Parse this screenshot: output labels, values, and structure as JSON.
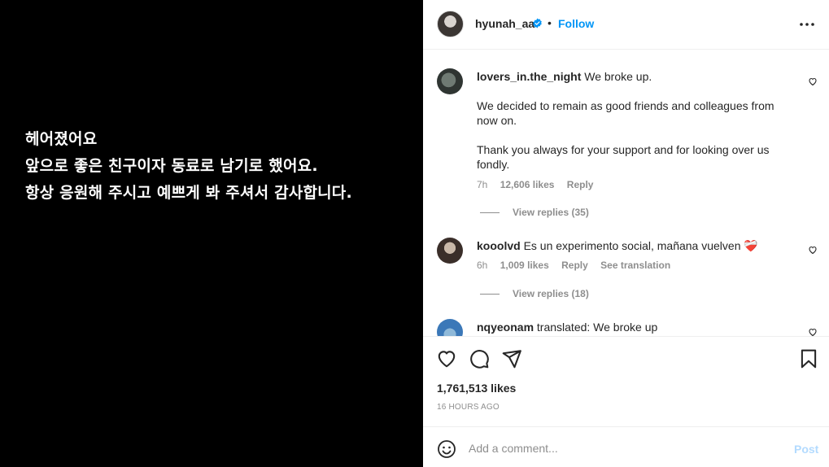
{
  "media": {
    "caption_lines": [
      "헤어졌어요",
      "앞으로 좋은 친구이자 동료로 남기로 했어요.",
      "항상 응원해 주시고 예쁘게 봐 주셔서 감사합니다."
    ]
  },
  "header": {
    "username": "hyunah_aa",
    "separator": "•",
    "follow_label": "Follow",
    "verified_icon": "verified-badge-icon",
    "accent_color": "#0095f6"
  },
  "comments": [
    {
      "username": "lovers_in.the_night",
      "paragraphs": [
        "We broke up.",
        "We decided to remain as good friends and colleagues from now on.",
        "Thank you always for your support and for looking over us fondly."
      ],
      "time": "7h",
      "likes": "12,606 likes",
      "reply_label": "Reply",
      "view_replies": "View replies (35)"
    },
    {
      "username": "kooolvd",
      "text": "Es un experimento social, mañana vuelven",
      "emoji": "❤️‍🩹",
      "time": "6h",
      "likes": "1,009 likes",
      "reply_label": "Reply",
      "translation_label": "See translation",
      "view_replies": "View replies (18)"
    },
    {
      "username": "nqyeonam",
      "text": "translated: We broke up"
    }
  ],
  "actions": {
    "likes_count": "1,761,513 likes",
    "timestamp": "16 HOURS AGO"
  },
  "add_comment": {
    "placeholder": "Add a comment...",
    "post_label": "Post",
    "post_color": "#b3dbff"
  }
}
